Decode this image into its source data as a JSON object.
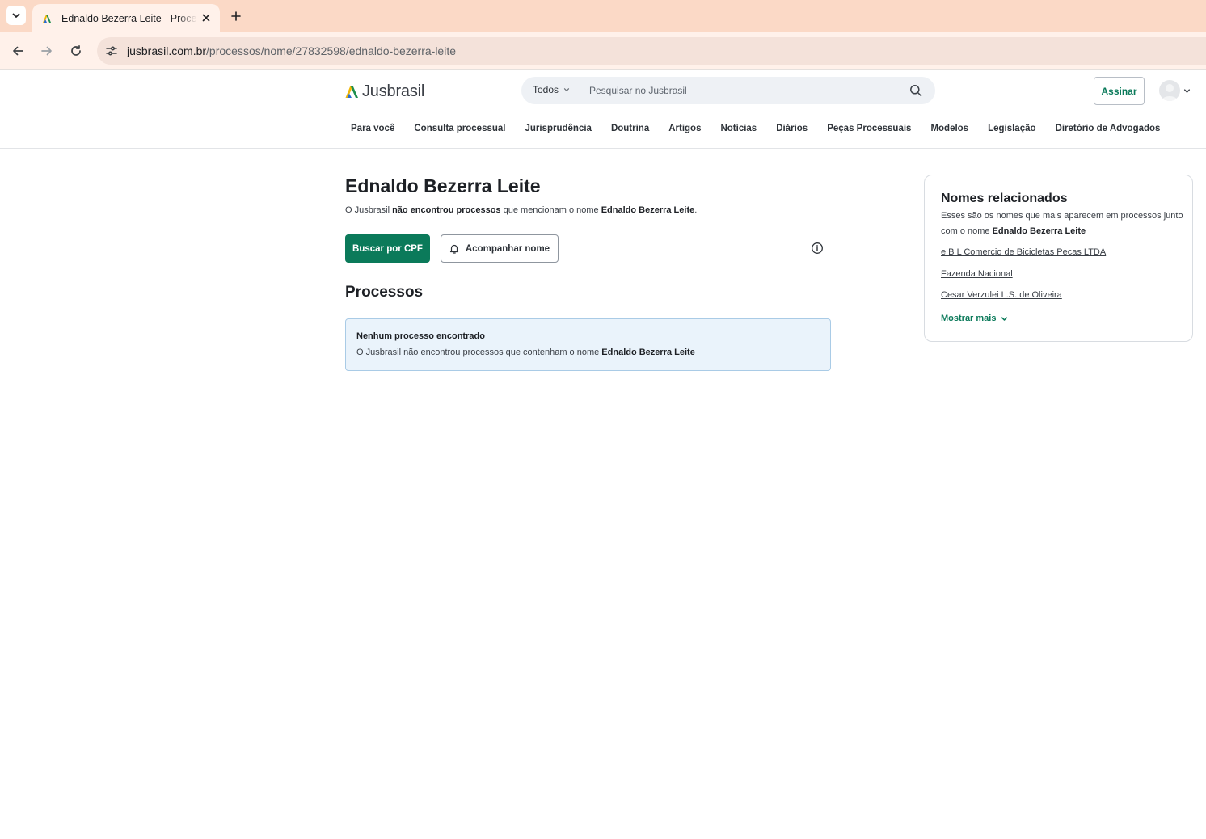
{
  "browser": {
    "tab_title": "Ednaldo Bezerra Leite - Process",
    "url_host": "jusbrasil.com.br",
    "url_path": "/processos/nome/27832598/ednaldo-bezerra-leite"
  },
  "header": {
    "logo_text": "Jusbrasil",
    "search_scope": "Todos",
    "search_placeholder": "Pesquisar no Jusbrasil",
    "subscribe_label": "Assinar",
    "nav": [
      "Para você",
      "Consulta processual",
      "Jurisprudência",
      "Doutrina",
      "Artigos",
      "Notícias",
      "Diários",
      "Peças Processuais",
      "Modelos",
      "Legislação",
      "Diretório de Advogados"
    ]
  },
  "main": {
    "title": "Ednaldo Bezerra Leite",
    "subtitle_pre": "O Jusbrasil ",
    "subtitle_bold": "não encontrou processos",
    "subtitle_mid": " que mencionam o nome ",
    "subtitle_name": "Ednaldo Bezerra Leite",
    "subtitle_end": ".",
    "btn_cpf": "Buscar por CPF",
    "btn_follow": "Acompanhar nome",
    "section_title": "Processos",
    "notice_title": "Nenhum processo encontrado",
    "notice_text": "O Jusbrasil não encontrou processos que contenham o nome ",
    "notice_name": "Ednaldo Bezerra Leite"
  },
  "related": {
    "title": "Nomes relacionados",
    "desc": "Esses são os nomes que mais aparecem em processos junto com o nome ",
    "desc_name": "Ednaldo Bezerra Leite",
    "links": [
      "e B L Comercio de Bicicletas Pecas LTDA",
      "Fazenda Nacional",
      "Cesar Verzulei L.S. de Oliveira"
    ],
    "show_more": "Mostrar mais"
  },
  "colors": {
    "brand_green": "#0b7a5a",
    "tabstrip": "#fbd9c6",
    "notice_bg": "#eaf3fb"
  }
}
